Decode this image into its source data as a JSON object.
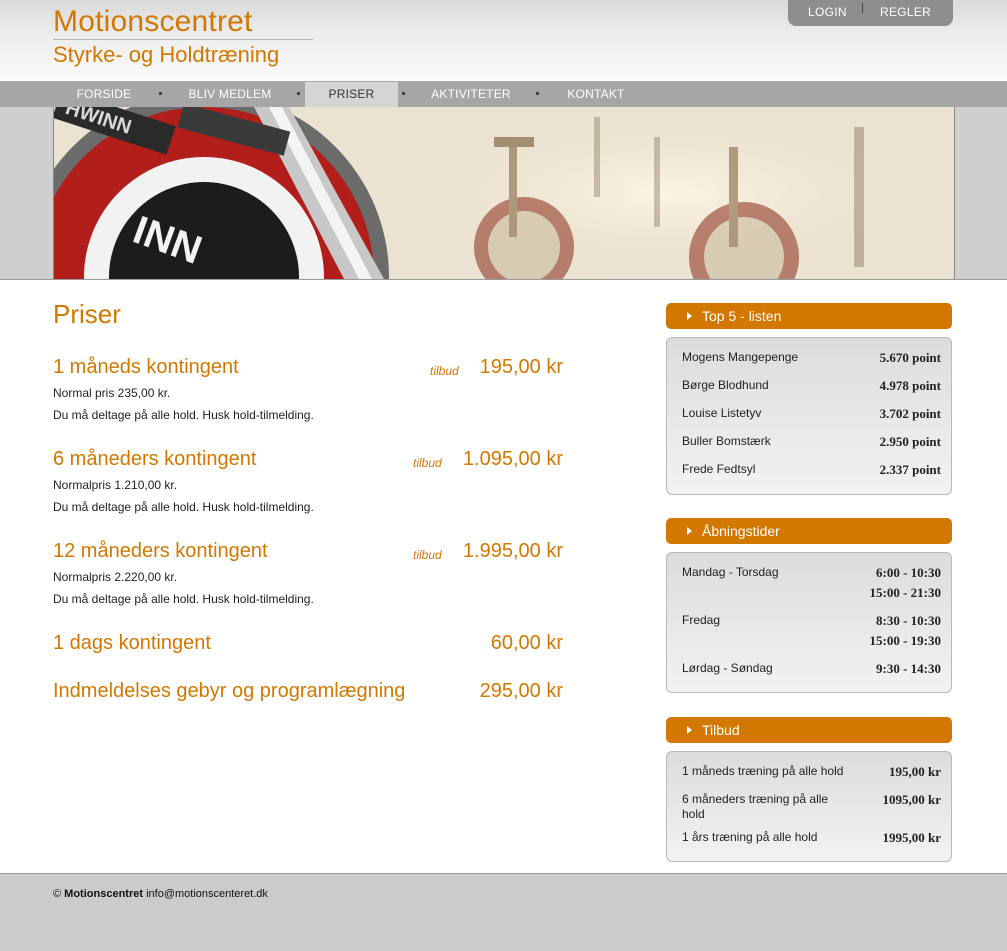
{
  "header": {
    "title": "Motionscentret",
    "subtitle": "Styrke- og Holdtræning",
    "top_links": [
      "LOGIN",
      "REGLER"
    ]
  },
  "nav": {
    "items": [
      "FORSIDE",
      "BLIV MEDLEM",
      "PRISER",
      "AKTIVITETER",
      "KONTAKT"
    ],
    "active": "PRISER"
  },
  "main": {
    "title": "Priser",
    "prices": [
      {
        "name": "1 måneds kontingent",
        "tag": "tilbud",
        "price": "195,00 kr",
        "lines": [
          "Normal pris 235,00 kr.",
          "Du må deltage på alle hold. Husk hold-tilmelding."
        ]
      },
      {
        "name": "6 måneders kontingent",
        "tag": "tilbud",
        "price": "1.095,00 kr",
        "lines": [
          "Normalpris 1.210,00 kr.",
          "Du må deltage på alle hold. Husk hold-tilmelding."
        ]
      },
      {
        "name": "12 måneders kontingent",
        "tag": "tilbud",
        "price": "1.995,00 kr",
        "lines": [
          "Normalpris 2.220,00 kr.",
          "Du må deltage på alle hold. Husk hold-tilmelding."
        ]
      },
      {
        "name": "1 dags kontingent",
        "tag": "",
        "price": "60,00 kr",
        "lines": []
      },
      {
        "name": "Indmeldelses gebyr og programlægning",
        "tag": "",
        "price": "295,00 kr",
        "lines": []
      }
    ]
  },
  "sidebar": {
    "top5": {
      "title": "Top 5 - listen",
      "rows": [
        {
          "name": "Mogens Mangepenge",
          "value": "5.670 point"
        },
        {
          "name": "Børge Blodhund",
          "value": "4.978 point"
        },
        {
          "name": "Louise Listetyv",
          "value": "3.702 point"
        },
        {
          "name": "Buller Bomstærk",
          "value": "2.950 point"
        },
        {
          "name": "Frede Fedtsyl",
          "value": "2.337 point"
        }
      ]
    },
    "hours": {
      "title": "Åbningstider",
      "rows": [
        {
          "day": "Mandag - Torsdag",
          "times": [
            "6:00 - 10:30",
            "15:00 - 21:30"
          ]
        },
        {
          "day": "Fredag",
          "times": [
            "8:30 - 10:30",
            "15:00 - 19:30"
          ]
        },
        {
          "day": "Lørdag - Søndag",
          "times": [
            "9:30 - 14:30"
          ]
        }
      ]
    },
    "offers": {
      "title": "Tilbud",
      "rows": [
        {
          "name": "1 måneds træning på alle hold",
          "value": "195,00 kr"
        },
        {
          "name": "6 måneders træning på alle hold",
          "value": "1095,00 kr"
        },
        {
          "name": "1 års træning på alle hold",
          "value": "1995,00 kr"
        }
      ]
    }
  },
  "footer": {
    "copyright": "©",
    "brand": "Motionscentret",
    "email": "info@motionscenteret.dk"
  },
  "colors": {
    "accent": "#d27800",
    "nav": "#a6a6a6",
    "footer": "#cbcbcb"
  }
}
